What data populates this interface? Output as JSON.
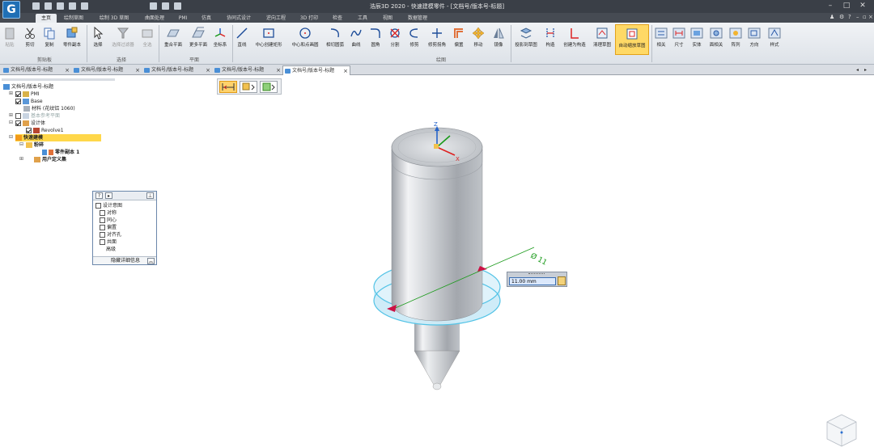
{
  "app": {
    "title": "浩辰3D 2020 - 快速建模零件 - [文档号/版本号-标题]",
    "logo": "G"
  },
  "menu": {
    "tabs": [
      "主页",
      "绘制草图",
      "绘制 3D 草图",
      "曲面处理",
      "PMI",
      "仿真",
      "协同式设计",
      "逆向工程",
      "3D 打印",
      "检查",
      "工具",
      "视图",
      "数据管理"
    ],
    "active_tab": "主页"
  },
  "ribbon": {
    "clipboard": {
      "paste": "粘贴",
      "cut": "剪切",
      "copy": "复制",
      "part_copy": "零件副本",
      "group": "剪贴板"
    },
    "select": {
      "select": "选择",
      "filter": "选择过滤器",
      "all": "全选",
      "group": "选择"
    },
    "plane": {
      "coincident": "重合平面",
      "more": "更多平面",
      "coord": "坐标系",
      "group": "平面"
    },
    "draw": {
      "items": [
        "直线",
        "中心创建矩形",
        "中心和点画圆",
        "相切圆弧",
        "曲线",
        "圆角",
        "分割",
        "修剪",
        "修剪拐角",
        "偏置",
        "移动",
        "镜像"
      ],
      "group": "绘图"
    },
    "project": {
      "project": "投影到草图",
      "construct": "构造",
      "create_construct": "创建为构造",
      "clean": "清理草图",
      "auto_zoom": "自动缩放草图"
    },
    "relate": [
      "相关",
      "尺寸",
      "实体",
      "面相关",
      "阵列",
      "方向",
      "样式"
    ]
  },
  "doc_tabs": [
    "文档号/版本号-标题",
    "文档号/版本号-标题",
    "文档号/版本号-标题",
    "文档号/版本号-标题",
    "文档号/版本号-标题"
  ],
  "tree": {
    "root": "文档号/版本号-标题",
    "pmi": "PMI",
    "base": "Base",
    "material": "材料 (花纹铝 1060)",
    "ref_planes": "基本参考平面",
    "design_body": "设计体",
    "revolve": "Revolve1",
    "quick_model": "快速建模",
    "parts": "粉碎",
    "part_copy": "零件副本 1",
    "user_defined": "用户定义集"
  },
  "design_intent": {
    "title": "设计意图",
    "items": [
      "对称",
      "同心",
      "偏置",
      "对齐孔",
      "共面"
    ],
    "advanced": "高级",
    "footer": "隐藏详细信息"
  },
  "dimension": {
    "value": "11.00 mm",
    "label": "Ø 11"
  },
  "triad": {
    "z": "Z",
    "x": "X"
  },
  "colors": {
    "accent": "#1f6fb5",
    "highlight": "#ffd966",
    "dimension": "#cc1144",
    "green": "#19a319"
  }
}
